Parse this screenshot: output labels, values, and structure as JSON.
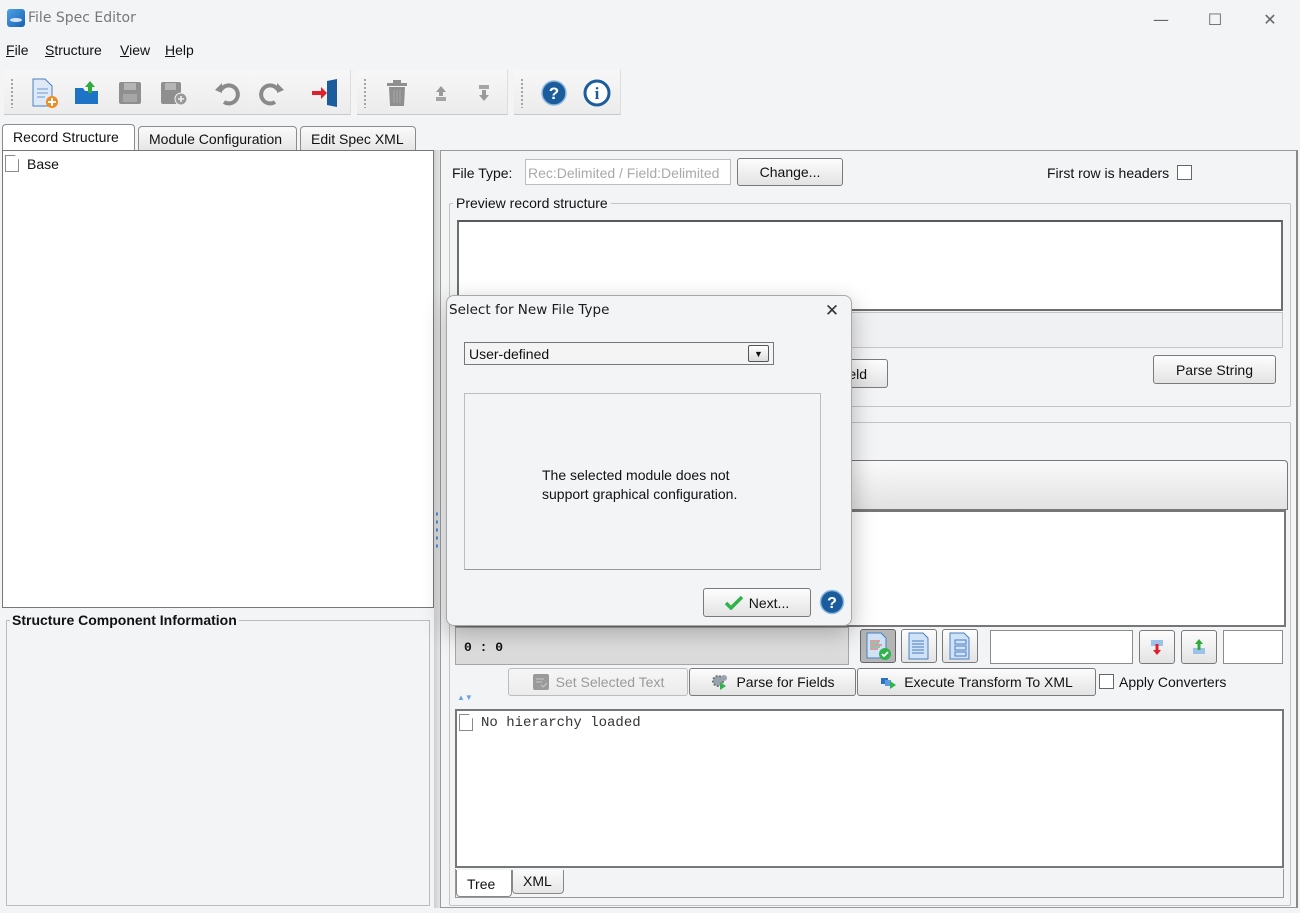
{
  "window": {
    "title": "File Spec Editor",
    "controls": {
      "minimize": "—",
      "maximize": "☐",
      "close": "✕"
    }
  },
  "menubar": {
    "items": [
      {
        "label": "File",
        "mnemonic": "F",
        "rest": "ile"
      },
      {
        "label": "Structure",
        "mnemonic": "S",
        "rest": "tructure"
      },
      {
        "label": "View",
        "mnemonic": "V",
        "rest": "iew"
      },
      {
        "label": "Help",
        "mnemonic": "H",
        "rest": "elp"
      }
    ]
  },
  "toolbar": {
    "groups": [
      {
        "buttons": [
          "new-spec",
          "open",
          "save",
          "save-as",
          "undo",
          "redo",
          "exit"
        ]
      },
      {
        "buttons": [
          "delete",
          "move-up",
          "move-down"
        ]
      },
      {
        "buttons": [
          "help",
          "about"
        ]
      }
    ]
  },
  "tabs": [
    {
      "label": "Record Structure",
      "active": true
    },
    {
      "label": "Module Configuration",
      "active": false
    },
    {
      "label": "Edit Spec XML",
      "active": false
    }
  ],
  "tree": {
    "items": [
      {
        "label": "Base",
        "icon": "document-icon"
      }
    ]
  },
  "structure_info": {
    "title": "Structure Component Information"
  },
  "record_panel": {
    "file_type_label": "File Type:",
    "file_type_value": "Rec:Delimited / Field:Delimited",
    "change_button": "Change...",
    "first_row_headers_label": "First row is headers",
    "first_row_headers_checked": false,
    "preview_group_title": "Preview record structure",
    "partial_button_label": "eld",
    "parse_string_button": "Parse String"
  },
  "transform_panel": {
    "position_readout": "0 : 0",
    "set_selected_text_button": "Set Selected Text",
    "parse_for_fields_button": "Parse for Fields",
    "execute_transform_button": "Execute Transform To XML",
    "apply_converters_label": "Apply Converters",
    "apply_converters_checked": false,
    "search_value": "",
    "small_field_value": "",
    "hierarchy_empty_text": "No hierarchy loaded",
    "bottom_tabs": [
      {
        "label": "Tree",
        "active": true
      },
      {
        "label": "XML",
        "active": false
      }
    ]
  },
  "dialog": {
    "title": "Select for New File Type",
    "close_glyph": "✕",
    "select_value": "User-defined",
    "message_line1": "The selected module does not",
    "message_line2": "support graphical configuration.",
    "next_button": "Next...",
    "help_glyph": "?"
  },
  "colors": {
    "window_bg": "#f3f4f6",
    "accent_blue": "#1a5c9c",
    "check_green": "#2fb34a",
    "exit_red": "#e0202a",
    "disabled_gray": "#8f8f8f"
  }
}
